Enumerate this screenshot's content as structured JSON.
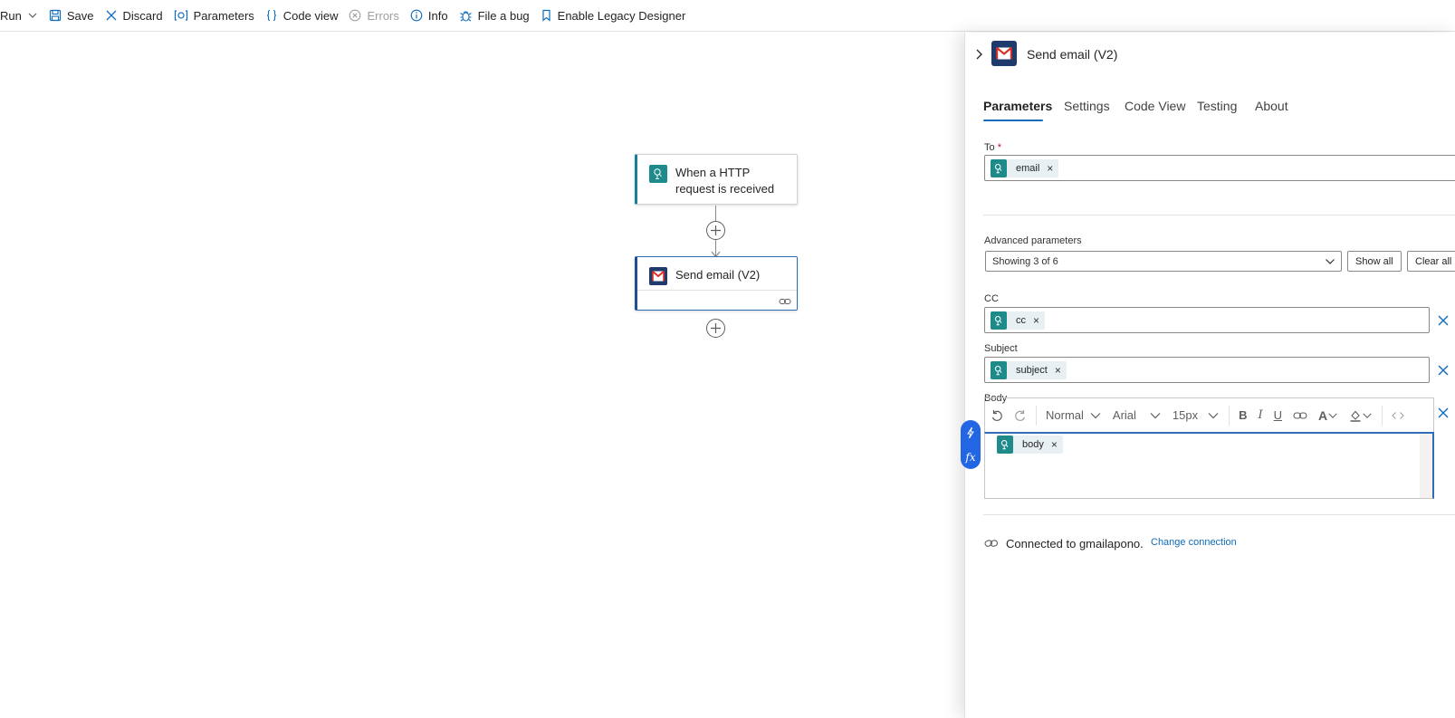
{
  "toolbar": {
    "run": "Run",
    "save": "Save",
    "discard": "Discard",
    "parameters": "Parameters",
    "code_view": "Code view",
    "errors": "Errors",
    "info": "Info",
    "file_bug": "File a bug",
    "legacy": "Enable Legacy Designer"
  },
  "canvas": {
    "trigger_title": "When a HTTP request is received",
    "action_title": "Send email (V2)"
  },
  "panel": {
    "title": "Send email (V2)",
    "tabs": [
      "Parameters",
      "Settings",
      "Code View",
      "Testing",
      "About"
    ],
    "to_label": "To",
    "to_required": "*",
    "to_token": "email",
    "advanced_label": "Advanced parameters",
    "advanced_value": "Showing 3 of 6",
    "show_all": "Show all",
    "clear_all": "Clear all",
    "cc_label": "CC",
    "cc_token": "cc",
    "subject_label": "Subject",
    "subject_token": "subject",
    "body_label": "Body",
    "body_token": "body",
    "token_remove": "×",
    "rte": {
      "style": "Normal",
      "font": "Arial",
      "size": "15px",
      "bold": "B",
      "italic": "I",
      "underline": "U",
      "font_color": "A"
    },
    "fx": "fx",
    "connected_text": "Connected to gmailapono.",
    "change_connection": "Change connection"
  },
  "colors": {
    "accent": "#0f6cbd",
    "token_icon": "#1f8a8a",
    "gmail_bg": "#1f3b6e"
  }
}
